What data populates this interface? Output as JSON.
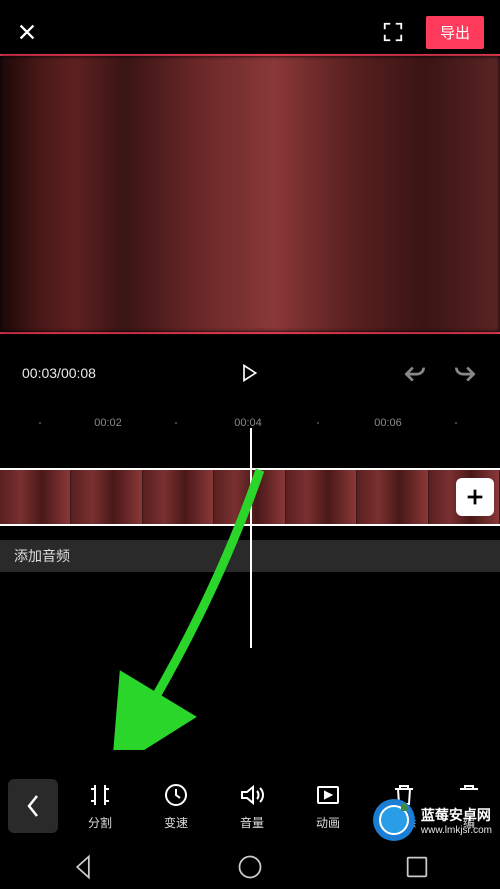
{
  "topbar": {
    "export_label": "导出"
  },
  "controls": {
    "time_current": "00:03",
    "time_total": "00:08"
  },
  "ruler": {
    "marks": [
      "00:02",
      "00:04",
      "00:06"
    ]
  },
  "audio": {
    "add_label": "添加音频"
  },
  "toolbar": {
    "split": "分割",
    "speed": "变速",
    "volume": "音量",
    "animation": "动画",
    "delete": "删除",
    "edit": "编"
  },
  "watermark": {
    "title": "蓝莓安卓网",
    "url": "www.lmkjsr.com"
  }
}
